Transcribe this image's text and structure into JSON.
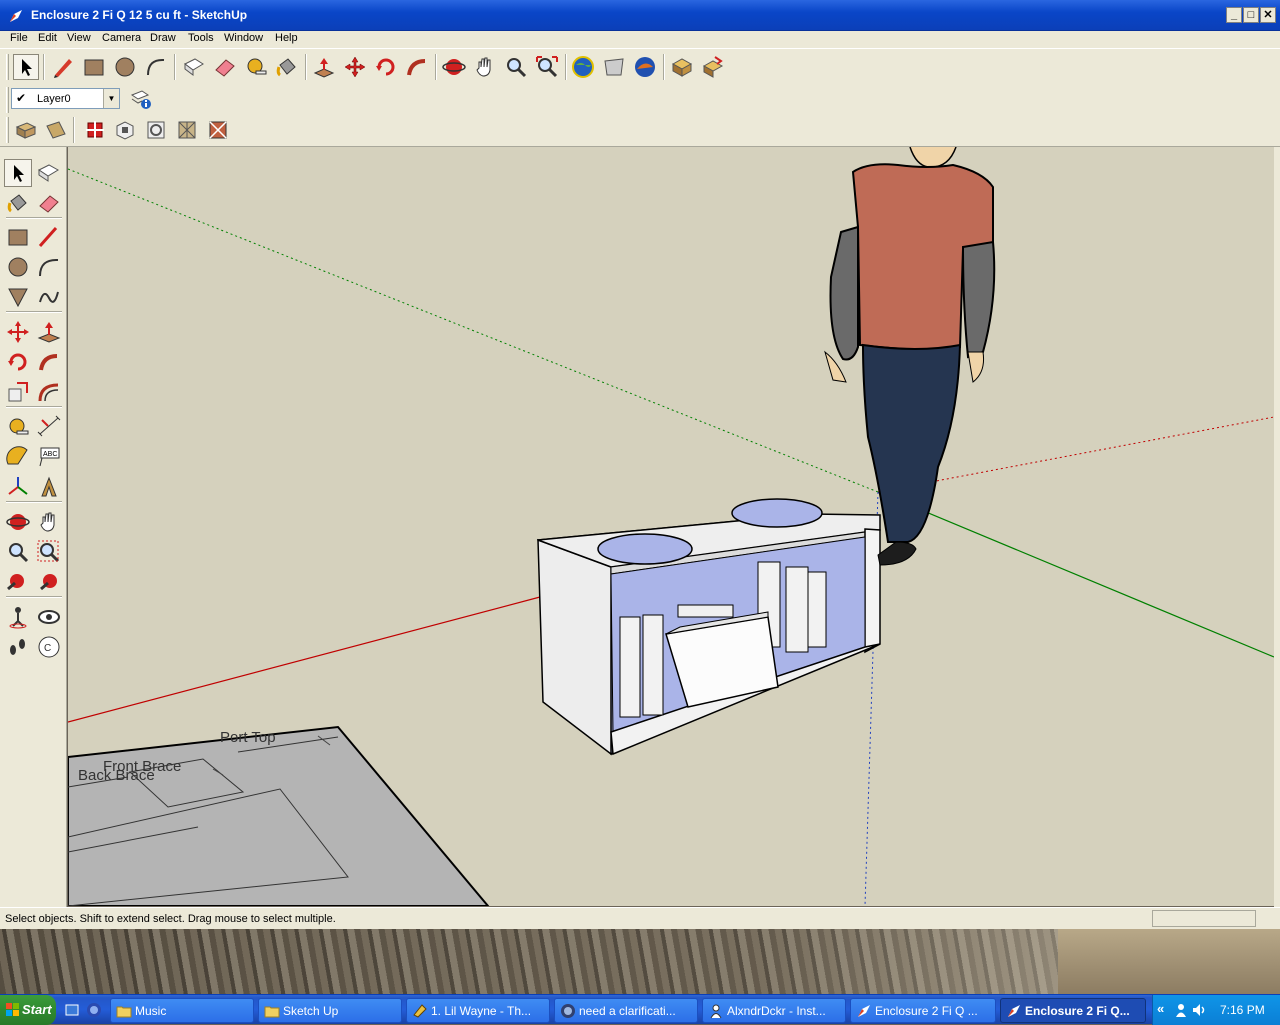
{
  "window": {
    "title": "Enclosure 2 Fi Q 12 5 cu ft - SketchUp",
    "controls": {
      "minimize": "_",
      "maximize": "□",
      "close": "✕"
    }
  },
  "menu": [
    "File",
    "Edit",
    "View",
    "Camera",
    "Draw",
    "Tools",
    "Window",
    "Help"
  ],
  "toolbar": {
    "main_icons": [
      "select-icon",
      "pencil-icon",
      "rectangle-icon",
      "circle-icon",
      "arc-icon",
      "make-component-icon",
      "eraser-icon",
      "tape-measure-icon",
      "paint-bucket-icon",
      "push-pull-icon",
      "move-icon",
      "rotate-icon",
      "follow-me-icon",
      "orbit-icon",
      "pan-icon",
      "zoom-icon",
      "zoom-extents-icon",
      "google-earth-icon",
      "get-models-icon",
      "share-model-icon",
      "3d-warehouse-icon",
      "components-icon"
    ],
    "layer": {
      "value": "Layer0"
    },
    "view_icons": [
      "iso-view-icon",
      "top-view-icon",
      "front-view-icon",
      "right-view-icon",
      "back-view-icon",
      "left-view-icon",
      "xray-icon"
    ]
  },
  "left_tools": [
    "select-icon",
    "make-component-icon",
    "paint-bucket-icon",
    "eraser-icon",
    "rectangle-icon",
    "line-icon",
    "circle-icon",
    "arc-icon",
    "polygon-icon",
    "freehand-icon",
    "move-icon",
    "push-pull-icon",
    "rotate-icon",
    "follow-me-icon",
    "scale-icon",
    "offset-icon",
    "tape-measure-icon",
    "dimension-icon",
    "protractor-icon",
    "text-icon",
    "axes-icon",
    "3d-text-icon",
    "orbit-icon",
    "pan-icon",
    "zoom-icon",
    "zoom-window-icon",
    "previous-view-icon",
    "next-view-icon",
    "position-camera-icon",
    "look-around-icon",
    "walk-icon",
    "section-plane-icon"
  ],
  "viewport": {
    "labels": {
      "port_top": "Port Top",
      "front_brace": "Front Brace",
      "back_brace": "Back Brace"
    },
    "colors": {
      "background": "#d5d1bd",
      "red_axis": "#c00000",
      "green_axis": "#008000",
      "box_fill": "#f2f2f2",
      "hole_fill": "#aab4e8"
    }
  },
  "status": {
    "message": "Select objects. Shift to extend select. Drag mouse to select multiple."
  },
  "taskbar": {
    "start": "Start",
    "tasks": [
      {
        "label": "Music",
        "icon": "folder-icon"
      },
      {
        "label": "Sketch Up",
        "icon": "folder-icon"
      },
      {
        "label": "1. Lil Wayne - Th...",
        "icon": "winamp-icon"
      },
      {
        "label": "need a clarificati...",
        "icon": "browser-icon"
      },
      {
        "label": "AlxndrDckr - Inst...",
        "icon": "messenger-icon"
      },
      {
        "label": "Enclosure 2 Fi Q ...",
        "icon": "sketchup-icon"
      },
      {
        "label": "Enclosure 2 Fi Q...",
        "icon": "sketchup-icon"
      }
    ],
    "tray_chevron": "«",
    "clock": "7:16 PM"
  }
}
